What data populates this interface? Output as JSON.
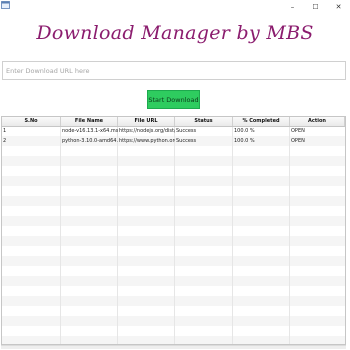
{
  "window": {
    "controls": {
      "minimize": "–",
      "maximize": "☐",
      "close": "✕"
    }
  },
  "app": {
    "title": "Download Manager by MBS",
    "url_placeholder": "Enter Download URL here",
    "url_value": "",
    "start_label": "Start Download",
    "accent_color": "#8b1c6e",
    "button_color": "#2ecc5f"
  },
  "table": {
    "headers": [
      "S.No",
      "File Name",
      "File URL",
      "Status",
      "% Completed",
      "Action"
    ],
    "rows": [
      [
        "1",
        "node-v16.13.1-x64.msi",
        "https://nodejs.org/dist/v16....",
        "Success",
        "100.0 %",
        "OPEN"
      ],
      [
        "2",
        "python-3.10.0-amd64.exe",
        "https://www.python.org/ftp...",
        "Success",
        "100.0 %",
        "OPEN"
      ]
    ]
  }
}
